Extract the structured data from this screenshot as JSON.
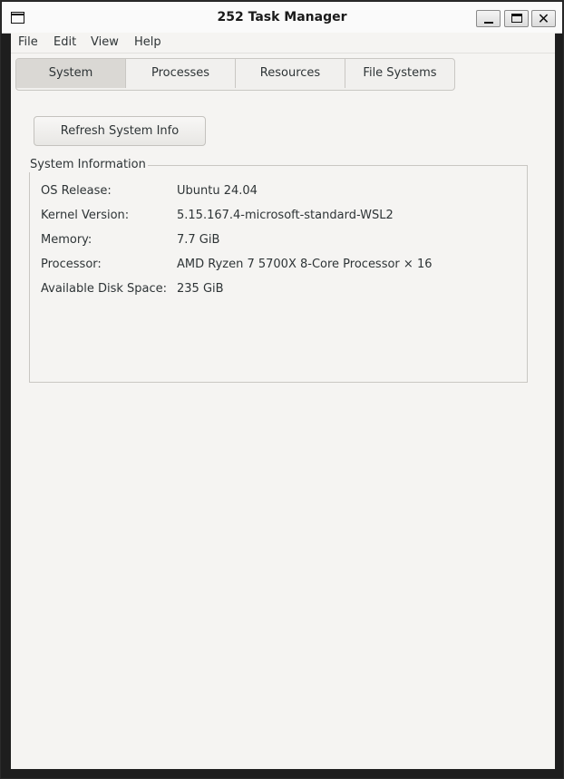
{
  "window": {
    "title": "252 Task Manager",
    "controls": {
      "minimize": "_",
      "maximize": "□",
      "close": "✕"
    }
  },
  "menubar": {
    "items": [
      {
        "label": "File"
      },
      {
        "label": "Edit"
      },
      {
        "label": "View"
      },
      {
        "label": "Help"
      }
    ]
  },
  "tabs": [
    {
      "label": "System",
      "active": true
    },
    {
      "label": "Processes",
      "active": false
    },
    {
      "label": "Resources",
      "active": false
    },
    {
      "label": "File Systems",
      "active": false
    }
  ],
  "system": {
    "refresh_label": "Refresh System Info",
    "group_title": "System Information",
    "rows": [
      {
        "label": "OS Release:",
        "value": "Ubuntu 24.04"
      },
      {
        "label": "Kernel Version:",
        "value": "5.15.167.4-microsoft-standard-WSL2"
      },
      {
        "label": "Memory:",
        "value": "7.7 GiB"
      },
      {
        "label": "Processor:",
        "value": "AMD Ryzen 7 5700X 8-Core Processor × 16"
      },
      {
        "label": "Available Disk Space:",
        "value": "235 GiB"
      }
    ]
  }
}
